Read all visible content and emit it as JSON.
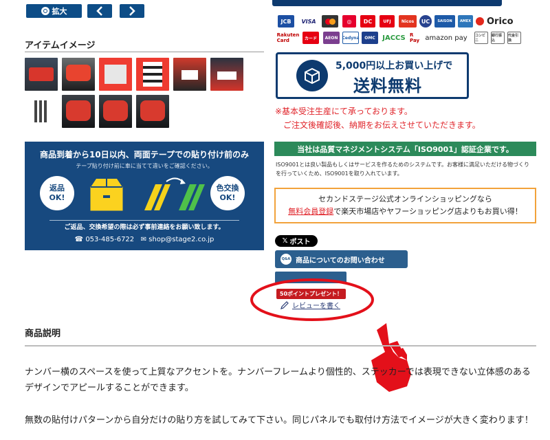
{
  "gallery": {
    "zoom_label": "拡大",
    "prev_icon": "chevron-left-icon",
    "next_icon": "chevron-right-icon",
    "title": "アイテムイメージ",
    "thumb_count": 10
  },
  "promo": {
    "title": "商品到着から10日以内、両面テープでの貼り付け前のみ",
    "subtitle": "テープ貼り付け前に車に当てて違いをご確認ください。",
    "return_label_1": "返品",
    "return_label_2": "OK!",
    "exchange_label_1": "色交換",
    "exchange_label_2": "OK!",
    "note": "ご返品、交換希望の際は必ず事前連絡をお願い致します。",
    "phone": "053-485-6722",
    "email": "shop@stage2.co.jp"
  },
  "payments": [
    "JCB",
    "VISA",
    "MC",
    "Diners",
    "UFJ",
    "Nicos",
    "UC",
    "SAISON",
    "AMEX",
    "DC",
    "Orico",
    "Rakuten Card",
    "カード",
    "AEON",
    "Cedyna",
    "OMC",
    "JACCS",
    "R Pay",
    "amazon pay",
    "コンビニ",
    "銀行振込",
    "代金引換"
  ],
  "shipping": {
    "top": "5,000円以上お買い上げで",
    "main": "送料無料"
  },
  "notice": {
    "line1": "※基本受注生産にて承っております。",
    "line2": "ご注文後確認後、納期をお伝えさせていただきます。"
  },
  "iso": {
    "heading": "当社は品質マネジメントシステム「ISO9001」認証企業です。",
    "body": "ISO9001とは良い製品もしくはサービスを作るためのシステムです。お客様に満足いただける物づくりを行っていくため、ISO9001を取り入れています。"
  },
  "second_stage": {
    "line1": "セカンドステージ公式オンラインショッピングなら",
    "link": "無料会員登録",
    "line2": "で楽天市場店やヤフーショッピング店よりもお買い得！"
  },
  "social": {
    "post_label": "ポスト"
  },
  "inquiry": {
    "label": "商品についてのお問い合わせ",
    "icon_text": "Q&A"
  },
  "review": {
    "points": "50ポイントプレゼント！",
    "label": "レビューを書く"
  },
  "description": {
    "title": "商品説明",
    "para1": "ナンバー横のスペースを使って上質なアクセントを。ナンバーフレームより個性的、ステッカーでは表現できない立体感のあるデザインでアピールすることができます。",
    "para2": "無数の貼付けパターンから自分だけの貼り方を試してみて下さい。同じパネルでも取付け方法でイメージが大きく変わります！"
  },
  "colors": {
    "navy": "#0d4d87",
    "red": "#e0242a",
    "green": "#2c8a5a",
    "orange": "#f2a23a",
    "annotation": "#e3101a"
  }
}
